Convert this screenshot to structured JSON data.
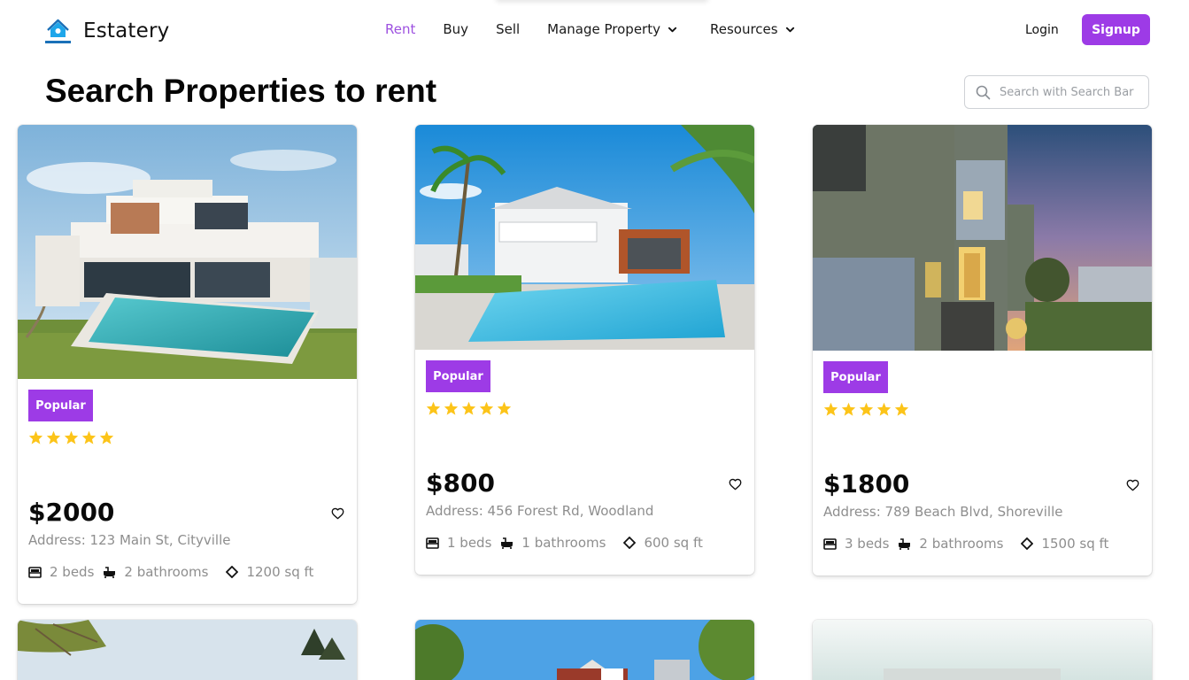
{
  "brand": {
    "name": "Estatery",
    "accent": "#9d3be6",
    "nav_active": "#9d51e0",
    "star_color": "#fcc419"
  },
  "nav": {
    "items": [
      {
        "label": "Rent",
        "active": true
      },
      {
        "label": "Buy"
      },
      {
        "label": "Sell"
      },
      {
        "label": "Manage Property",
        "dropdown": true
      },
      {
        "label": "Resources",
        "dropdown": true
      }
    ],
    "login": "Login",
    "signup": "Signup"
  },
  "page": {
    "title": "Search Properties to rent",
    "search_placeholder": "Search with Search Bar"
  },
  "listings": [
    {
      "badge": "Popular",
      "rating": 5,
      "price": "$2000",
      "address": "Address: 123 Main St, Cityville",
      "beds": "2 beds",
      "baths": "2 bathrooms",
      "sqft": "1200 sq ft",
      "photo": "modern-villa-with-pool"
    },
    {
      "badge": "Popular",
      "rating": 5,
      "price": "$800",
      "address": "Address: 456 Forest Rd, Woodland",
      "beds": "1 beds",
      "baths": "1 bathrooms",
      "sqft": "600 sq ft",
      "photo": "white-house-with-pool-and-palms"
    },
    {
      "badge": "Popular",
      "rating": 5,
      "price": "$1800",
      "address": "Address: 789 Beach Blvd, Shoreville",
      "beds": "3 beds",
      "baths": "2 bathrooms",
      "sqft": "1500 sq ft",
      "photo": "modern-house-at-dusk"
    }
  ]
}
